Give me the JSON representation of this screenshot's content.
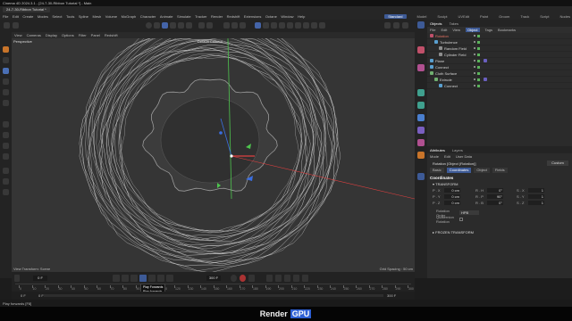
{
  "window": {
    "title": "Cinema 4D 2024.3.1 - [24-7-30-Ribbon Tutorial *] - Main"
  },
  "document_tab": "24-7-30-Ribbon Tutorial *",
  "menu": [
    "File",
    "Edit",
    "Create",
    "Modes",
    "Select",
    "Tools",
    "Spline",
    "Mesh",
    "Volume",
    "MoGraph",
    "Character",
    "Animate",
    "Simulate",
    "Tracker",
    "Render",
    "Redshift",
    "Extensions",
    "Octane",
    "Window",
    "Help"
  ],
  "layouts": [
    "Standard",
    "Model",
    "Sculpt",
    "UVEdit",
    "Paint",
    "Groom",
    "Track",
    "Script",
    "Nodes"
  ],
  "active_layout": "Standard",
  "viewport": {
    "menu": [
      "View",
      "Cameras",
      "Display",
      "Options",
      "Filter",
      "Panel",
      "Redshift"
    ],
    "label": "Perspective",
    "camera": "Default Camera",
    "transform_label": "View Transform: Scene",
    "grid_spacing": "Grid Spacing : 50 cm"
  },
  "side_label": "Move",
  "objects_panel": {
    "tabs": [
      "Objects",
      "Takes"
    ],
    "menu": [
      "File",
      "Edit",
      "View",
      "Object",
      "Tags",
      "Bookmarks"
    ],
    "active_menu": "Object",
    "items": [
      {
        "name": "Rotation",
        "indent": 0,
        "color": "#c0506a",
        "highlight": "#e07060"
      },
      {
        "name": "Turbulence",
        "indent": 1,
        "color": "#5aa0d0",
        "highlight": ""
      },
      {
        "name": "Random Field",
        "indent": 2,
        "color": "#8e8e8e",
        "highlight": ""
      },
      {
        "name": "Cylinder Field",
        "indent": 2,
        "color": "#8e8e8e",
        "highlight": ""
      },
      {
        "name": "Plane",
        "indent": 0,
        "color": "#5aa0d0",
        "highlight": ""
      },
      {
        "name": "Connect",
        "indent": 0,
        "color": "#5aa0d0",
        "highlight": ""
      },
      {
        "name": "Cloth Surface",
        "indent": 0,
        "color": "#70b070",
        "highlight": ""
      },
      {
        "name": "Extrude",
        "indent": 1,
        "color": "#70b070",
        "highlight": ""
      },
      {
        "name": "Connect",
        "indent": 2,
        "color": "#5aa0d0",
        "highlight": ""
      }
    ]
  },
  "attributes_panel": {
    "tabs": [
      "Attributes",
      "Layers"
    ],
    "menu": [
      "Mode",
      "Edit",
      "User Data"
    ],
    "object_title": "Rotation [Object (Rotation)]",
    "mode_value": "Custom",
    "sub_tabs": [
      "Basic",
      "Coordinates",
      "Object",
      "Fields"
    ],
    "active_sub_tab": "Coordinates",
    "section": "Coordinates",
    "transform_header": "TRANSFORM",
    "frozen_header": "FROZEN TRANSFORM",
    "coords": [
      {
        "p_label": "P . X",
        "p_val": "0 cm",
        "s_label": "S . X",
        "s_val": "1",
        "r_label": "R . H",
        "r_val": "0°"
      },
      {
        "p_label": "P . Y",
        "p_val": "0 cm",
        "s_label": "S . Y",
        "s_val": "1",
        "r_label": "R . P",
        "r_val": "90°"
      },
      {
        "p_label": "P . Z",
        "p_val": "0 cm",
        "s_label": "S . Z",
        "s_val": "1",
        "r_label": "R . B",
        "r_val": "0°"
      }
    ],
    "rotation_order_label": "Rotation Order",
    "rotation_order_value": "HPB",
    "quaternion_label": "Quaternion Rotation"
  },
  "timeline": {
    "current_frame": "0 F",
    "start_frame": "0 F",
    "end_frame": "300 F",
    "field_left": "0 F",
    "field_right": "300 F",
    "ticks": [
      "0",
      "10",
      "20",
      "30",
      "40",
      "50",
      "60",
      "70",
      "80",
      "90",
      "100",
      "110",
      "120",
      "130",
      "140",
      "150",
      "160",
      "170",
      "180",
      "190",
      "200",
      "210",
      "220",
      "230",
      "240",
      "250",
      "260",
      "270",
      "280",
      "290",
      "300"
    ],
    "tooltip_title": "Play Forwards",
    "tooltip_desc": "Play forwards",
    "tooltip_key": "[F8]"
  },
  "status": "Play forwards [F8]",
  "watermark": {
    "left": "Render",
    "right": "GPU"
  },
  "colors": {
    "accent": "#3d5a96",
    "viewport_bg": "#353535",
    "axis_y": "#4ec44e",
    "axis_x": "#e04040",
    "axis_z": "#3b6ee0"
  }
}
